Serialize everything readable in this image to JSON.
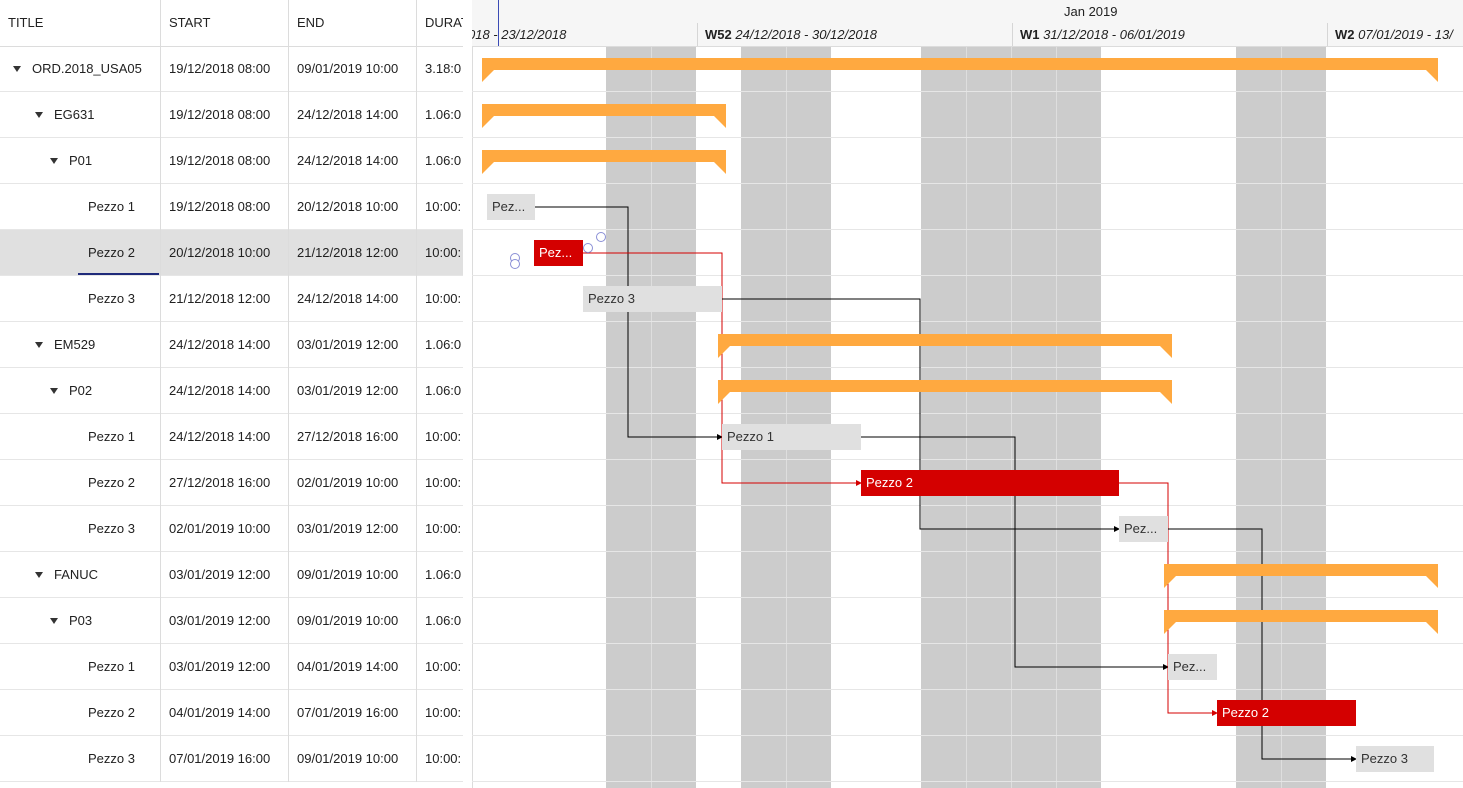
{
  "grid": {
    "columns": [
      "TITLE",
      "START",
      "END",
      "DURATION"
    ],
    "rows": [
      {
        "title": "ORD.2018_USA05",
        "start": "19/12/2018 08:00",
        "end": "09/01/2019 10:00",
        "duration": "3.18:0",
        "level": 0,
        "expandable": true
      },
      {
        "title": "EG631",
        "start": "19/12/2018 08:00",
        "end": "24/12/2018 14:00",
        "duration": "1.06:0",
        "level": 1,
        "expandable": true
      },
      {
        "title": "P01",
        "start": "19/12/2018 08:00",
        "end": "24/12/2018 14:00",
        "duration": "1.06:0",
        "level": 2,
        "expandable": true
      },
      {
        "title": "Pezzo 1",
        "start": "19/12/2018 08:00",
        "end": "20/12/2018 10:00",
        "duration": "10:00:",
        "level": 3,
        "expandable": false
      },
      {
        "title": "Pezzo 2",
        "start": "20/12/2018 10:00",
        "end": "21/12/2018 12:00",
        "duration": "10:00:",
        "level": 3,
        "expandable": false,
        "selected": true
      },
      {
        "title": "Pezzo 3",
        "start": "21/12/2018 12:00",
        "end": "24/12/2018 14:00",
        "duration": "10:00:",
        "level": 3,
        "expandable": false
      },
      {
        "title": "EM529",
        "start": "24/12/2018 14:00",
        "end": "03/01/2019 12:00",
        "duration": "1.06:0",
        "level": 1,
        "expandable": true
      },
      {
        "title": "P02",
        "start": "24/12/2018 14:00",
        "end": "03/01/2019 12:00",
        "duration": "1.06:0",
        "level": 2,
        "expandable": true
      },
      {
        "title": "Pezzo 1",
        "start": "24/12/2018 14:00",
        "end": "27/12/2018 16:00",
        "duration": "10:00:",
        "level": 3,
        "expandable": false
      },
      {
        "title": "Pezzo 2",
        "start": "27/12/2018 16:00",
        "end": "02/01/2019 10:00",
        "duration": "10:00:",
        "level": 3,
        "expandable": false
      },
      {
        "title": "Pezzo 3",
        "start": "02/01/2019 10:00",
        "end": "03/01/2019 12:00",
        "duration": "10:00:",
        "level": 3,
        "expandable": false
      },
      {
        "title": "FANUC",
        "start": "03/01/2019 12:00",
        "end": "09/01/2019 10:00",
        "duration": "1.06:0",
        "level": 1,
        "expandable": true
      },
      {
        "title": "P03",
        "start": "03/01/2019 12:00",
        "end": "09/01/2019 10:00",
        "duration": "1.06:0",
        "level": 2,
        "expandable": true
      },
      {
        "title": "Pezzo 1",
        "start": "03/01/2019 12:00",
        "end": "04/01/2019 14:00",
        "duration": "10:00:",
        "level": 3,
        "expandable": false
      },
      {
        "title": "Pezzo 2",
        "start": "04/01/2019 14:00",
        "end": "07/01/2019 16:00",
        "duration": "10:00:",
        "level": 3,
        "expandable": false
      },
      {
        "title": "Pezzo 3",
        "start": "07/01/2019 16:00",
        "end": "09/01/2019 10:00",
        "duration": "10:00:",
        "level": 3,
        "expandable": false
      }
    ]
  },
  "timeline": {
    "month_label": "Jan 2019",
    "weeks": [
      {
        "num": "",
        "range": "018 - 23/12/2018"
      },
      {
        "num": "W52",
        "range": "24/12/2018 - 30/12/2018"
      },
      {
        "num": "W1",
        "range": "31/12/2018 - 06/01/2019"
      },
      {
        "num": "W2",
        "range": "07/01/2019 - 13/"
      }
    ]
  },
  "bars": [
    {
      "label": "",
      "kind": "summary"
    },
    {
      "label": "",
      "kind": "summary"
    },
    {
      "label": "",
      "kind": "summary"
    },
    {
      "label": "Pez...",
      "kind": "task"
    },
    {
      "label": "Pez...",
      "kind": "critical"
    },
    {
      "label": "Pezzo 3",
      "kind": "task"
    },
    {
      "label": "",
      "kind": "summary"
    },
    {
      "label": "",
      "kind": "summary"
    },
    {
      "label": "Pezzo 1",
      "kind": "task"
    },
    {
      "label": "Pezzo 2",
      "kind": "critical"
    },
    {
      "label": "Pez...",
      "kind": "task"
    },
    {
      "label": "",
      "kind": "summary"
    },
    {
      "label": "",
      "kind": "summary"
    },
    {
      "label": "Pez...",
      "kind": "task"
    },
    {
      "label": "Pezzo 2",
      "kind": "critical"
    },
    {
      "label": "Pezzo 3",
      "kind": "task"
    }
  ],
  "colors": {
    "summary": "#ffa940",
    "critical": "#d40000",
    "task": "#e0e0e0",
    "weekend": "#cccccc",
    "critical_link": "#d40000",
    "normal_link": "#000000"
  }
}
